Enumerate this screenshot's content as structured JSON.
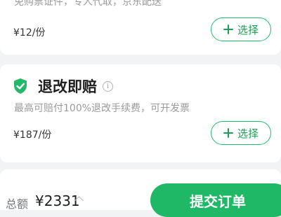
{
  "item_1": {
    "description": "免购票证件，专人代取，京东配送",
    "price": "¥12/份",
    "button_label": "选择"
  },
  "item_2": {
    "title": "退改即赔",
    "info_glyph": "i",
    "description": "最高可赔付100%退改手续费，可开发票",
    "price": "¥187/份",
    "button_label": "选择",
    "accent_color": "#25b86a"
  },
  "footer": {
    "total_label": "总额",
    "total_value": "¥2331",
    "submit_label": "提交订单",
    "submit_color": "#1fb866"
  }
}
